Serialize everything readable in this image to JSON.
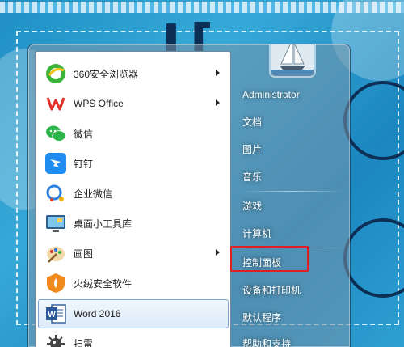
{
  "start_menu": {
    "programs": [
      {
        "label": "360安全浏览器",
        "icon": "browser-360-icon",
        "submenu": true
      },
      {
        "label": "WPS Office",
        "icon": "wps-office-icon",
        "submenu": true
      },
      {
        "label": "微信",
        "icon": "wechat-icon",
        "submenu": false
      },
      {
        "label": "钉钉",
        "icon": "dingtalk-icon",
        "submenu": false
      },
      {
        "label": "企业微信",
        "icon": "wecom-icon",
        "submenu": false
      },
      {
        "label": "桌面小工具库",
        "icon": "desktop-gadgets-icon",
        "submenu": false
      },
      {
        "label": "画图",
        "icon": "paint-icon",
        "submenu": true
      },
      {
        "label": "火绒安全软件",
        "icon": "huorong-security-icon",
        "submenu": false
      },
      {
        "label": "Word 2016",
        "icon": "word-icon",
        "submenu": false,
        "selected": true
      },
      {
        "label": "扫雷",
        "icon": "minesweeper-icon",
        "submenu": false
      }
    ],
    "user_avatar_icon": "sailboat-avatar-icon",
    "right_items": [
      {
        "label": "Administrator"
      },
      {
        "label": "文档"
      },
      {
        "label": "图片"
      },
      {
        "label": "音乐"
      },
      {
        "label": "游戏"
      },
      {
        "label": "计算机"
      },
      {
        "label": "控制面板",
        "highlighted": true
      },
      {
        "label": "设备和打印机"
      },
      {
        "label": "默认程序"
      },
      {
        "label": "帮助和支持"
      }
    ],
    "highlight_color": "#e02020"
  }
}
